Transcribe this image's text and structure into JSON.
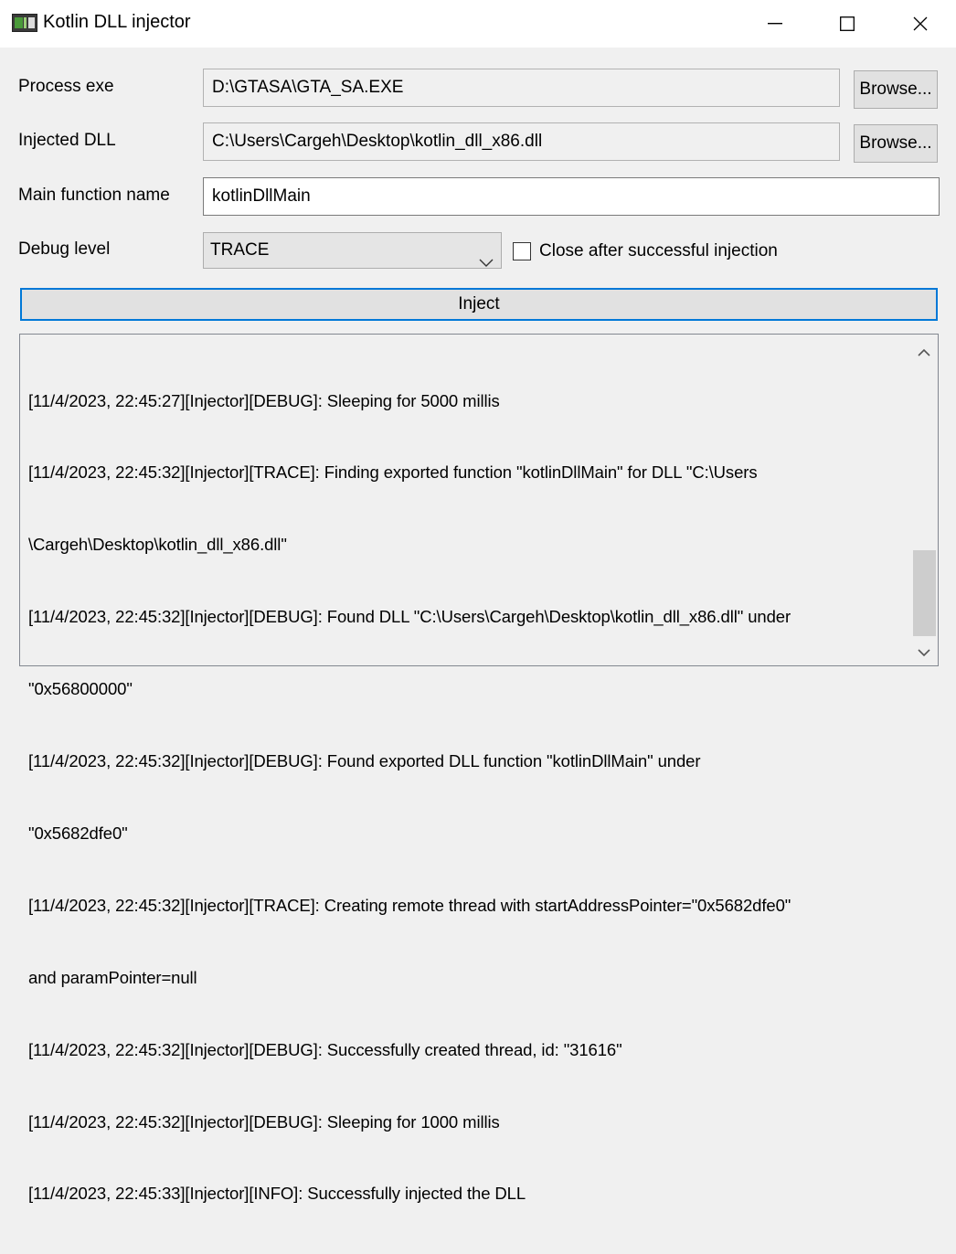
{
  "window": {
    "title": "Kotlin DLL injector",
    "icon": "app-window-icon",
    "controls": [
      "minimize-icon",
      "maximize-icon",
      "close-icon"
    ]
  },
  "form": {
    "process_label": "Process exe",
    "process_value": "D:\\GTASA\\GTA_SA.EXE",
    "dll_label": "Injected DLL",
    "dll_value": "C:\\Users\\Cargeh\\Desktop\\kotlin_dll_x86.dll",
    "browse_label": "Browse...",
    "main_label": "Main function name",
    "main_value": "kotlinDllMain",
    "debug_label": "Debug level",
    "debug_value": "TRACE",
    "close_after_label": "Close after successful injection",
    "close_after_checked": false,
    "inject_label": "Inject"
  },
  "log": {
    "lines": [
      "[11/4/2023, 22:45:27][Injector][DEBUG]: Sleeping for 5000 millis",
      "[11/4/2023, 22:45:32][Injector][TRACE]: Finding exported function \"kotlinDllMain\" for DLL \"C:\\Users",
      "\\Cargeh\\Desktop\\kotlin_dll_x86.dll\"",
      "[11/4/2023, 22:45:32][Injector][DEBUG]: Found DLL \"C:\\Users\\Cargeh\\Desktop\\kotlin_dll_x86.dll\" under",
      "\"0x56800000\"",
      "[11/4/2023, 22:45:32][Injector][DEBUG]: Found exported DLL function \"kotlinDllMain\" under",
      "\"0x5682dfe0\"",
      "[11/4/2023, 22:45:32][Injector][TRACE]: Creating remote thread with startAddressPointer=\"0x5682dfe0\"",
      "and paramPointer=null",
      "[11/4/2023, 22:45:32][Injector][DEBUG]: Successfully created thread, id: \"31616\"",
      "[11/4/2023, 22:45:32][Injector][DEBUG]: Sleeping for 1000 millis",
      "[11/4/2023, 22:45:33][Injector][INFO]: Successfully injected the DLL"
    ]
  },
  "colors": {
    "accent": "#0078d7",
    "background": "#f0f0f0"
  }
}
